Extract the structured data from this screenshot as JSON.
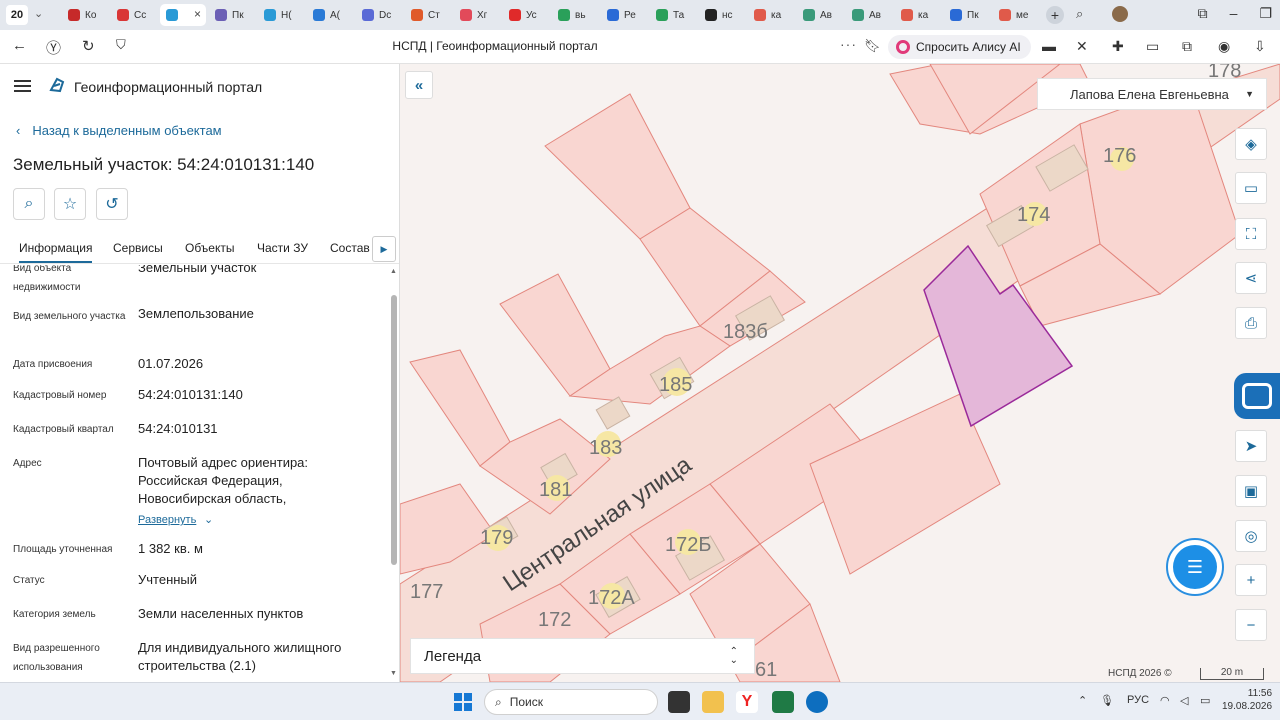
{
  "browser": {
    "tab_count": "20",
    "tabs": [
      {
        "label": "Ко",
        "color": "#c62a2a"
      },
      {
        "label": "Сс",
        "color": "#d93636"
      },
      {
        "label": "",
        "color": "#2a9ad6",
        "active": true
      },
      {
        "label": "Пк",
        "color": "#6b5fb5"
      },
      {
        "label": "Н(",
        "color": "#2a9ad6"
      },
      {
        "label": "А(",
        "color": "#2a7ad6"
      },
      {
        "label": "Dc",
        "color": "#5a6ad6"
      },
      {
        "label": "Ст",
        "color": "#e05a2a"
      },
      {
        "label": "Хг",
        "color": "#e24a5a"
      },
      {
        "label": "Ус",
        "color": "#e02a2a"
      },
      {
        "label": "вь",
        "color": "#2aa05a"
      },
      {
        "label": "Ре",
        "color": "#2a6ad6"
      },
      {
        "label": "Та",
        "color": "#2aa05a"
      },
      {
        "label": "нс",
        "color": "#222222"
      },
      {
        "label": "ка",
        "color": "#e05a4a"
      },
      {
        "label": "Ав",
        "color": "#3a9a7a"
      },
      {
        "label": "Ав",
        "color": "#3a9a7a"
      },
      {
        "label": "ка",
        "color": "#e05a4a"
      },
      {
        "label": "Пк",
        "color": "#2a6ad6"
      },
      {
        "label": "ме",
        "color": "#e05a4a"
      }
    ],
    "page_title": "НСПД | Геоинформационный портал",
    "alice_label": "Спросить Алису AI"
  },
  "panel": {
    "portal_title": "Геоинформационный портал",
    "back_label": "Назад к выделенным объектам",
    "title": "Земельный участок: 54:24:010131:140",
    "tabs": [
      "Информация",
      "Сервисы",
      "Объекты",
      "Части ЗУ",
      "Состав"
    ],
    "properties": [
      {
        "label": "Вид объекта недвижимости",
        "value": "Земельный участок"
      },
      {
        "label": "Вид земельного участка",
        "value": "Землепользование"
      },
      {
        "label": "Дата присвоения",
        "value": "01.07.2026"
      },
      {
        "label": "Кадастровый номер",
        "value": "54:24:010131:140"
      },
      {
        "label": "Кадастровый квартал",
        "value": "54:24:010131"
      },
      {
        "label": "Адрес",
        "value": "Почтовый адрес ориентира: Российская Федерация, Новосибирская область,"
      },
      {
        "label": "Площадь уточненная",
        "value": "1 382 кв. м"
      },
      {
        "label": "Статус",
        "value": "Учтенный"
      },
      {
        "label": "Категория земель",
        "value": "Земли населенных пунктов"
      },
      {
        "label": "Вид разрешенного использования",
        "value": "Для индивидуального жилищного строительства (2.1)"
      }
    ],
    "expand_label": "Развернуть"
  },
  "map": {
    "user_name": "Лапова Елена Евгеньевна",
    "street_label": "Центральная улица",
    "house_numbers": [
      "178",
      "176",
      "174",
      "183б",
      "185",
      "183",
      "181",
      "179",
      "177",
      "172Б",
      "172А",
      "172",
      "61"
    ],
    "legend_label": "Легенда",
    "copyright": "НСПД 2026 ©",
    "scale_label": "20 m",
    "colors": {
      "parcel_fill": "#f9d6d1",
      "parcel_line": "#e3877e",
      "selected_fill": "#e4b7d9",
      "selected_line": "#9a2a9a",
      "street_fill": "#f6ddd6"
    }
  },
  "taskbar": {
    "search_placeholder": "Поиск",
    "lang": "РУС",
    "time": "11:56",
    "date": "19.08.2026"
  }
}
